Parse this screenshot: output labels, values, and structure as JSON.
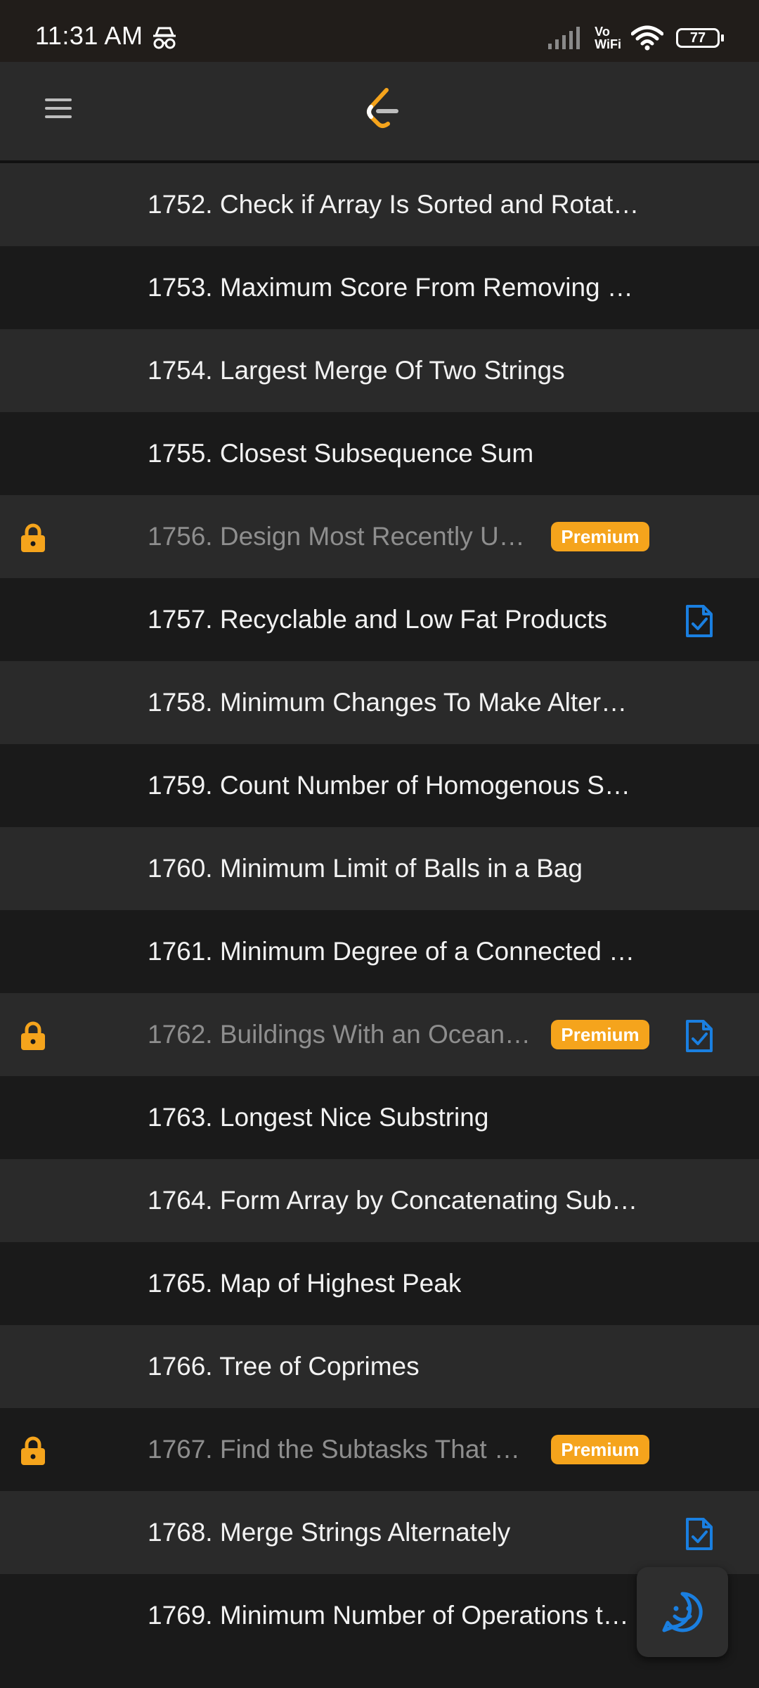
{
  "status_bar": {
    "time": "11:31 AM",
    "vo": "Vo",
    "wifi_label": "WiFi",
    "battery": "77",
    "icons": [
      "incognito-icon",
      "signal-icon",
      "wifi-icon",
      "battery-icon"
    ]
  },
  "header": {
    "menu_icon": "hamburger-menu-icon",
    "logo_icon": "leetcode-logo"
  },
  "colors": {
    "premium_badge": "#f5a41c",
    "lock": "#f5a41c",
    "solution_icon": "#1a7fe0",
    "row_light": "#2a2a2a",
    "row_dark": "#1a1a1a"
  },
  "problems": [
    {
      "title": "1752. Check if Array Is Sorted and Rotat…",
      "locked": false,
      "premium": "",
      "solution": false
    },
    {
      "title": "1753. Maximum Score From Removing …",
      "locked": false,
      "premium": "",
      "solution": false
    },
    {
      "title": "1754. Largest Merge Of Two Strings",
      "locked": false,
      "premium": "",
      "solution": false
    },
    {
      "title": "1755. Closest Subsequence Sum",
      "locked": false,
      "premium": "",
      "solution": false
    },
    {
      "title": "1756. Design Most Recently U…",
      "locked": true,
      "premium": "Premium",
      "solution": false
    },
    {
      "title": "1757. Recyclable and Low Fat Products",
      "locked": false,
      "premium": "",
      "solution": true
    },
    {
      "title": "1758. Minimum Changes To Make Alter…",
      "locked": false,
      "premium": "",
      "solution": false
    },
    {
      "title": "1759. Count Number of Homogenous S…",
      "locked": false,
      "premium": "",
      "solution": false
    },
    {
      "title": "1760. Minimum Limit of Balls in a Bag",
      "locked": false,
      "premium": "",
      "solution": false
    },
    {
      "title": "1761. Minimum Degree of a Connected …",
      "locked": false,
      "premium": "",
      "solution": false
    },
    {
      "title": "1762. Buildings With an Ocean…",
      "locked": true,
      "premium": "Premium",
      "solution": true
    },
    {
      "title": "1763. Longest Nice Substring",
      "locked": false,
      "premium": "",
      "solution": false
    },
    {
      "title": "1764. Form Array by Concatenating Sub…",
      "locked": false,
      "premium": "",
      "solution": false
    },
    {
      "title": "1765. Map of Highest Peak",
      "locked": false,
      "premium": "",
      "solution": false
    },
    {
      "title": "1766. Tree of Coprimes",
      "locked": false,
      "premium": "",
      "solution": false
    },
    {
      "title": "1767. Find the Subtasks That …",
      "locked": true,
      "premium": "Premium",
      "solution": false
    },
    {
      "title": "1768. Merge Strings Alternately",
      "locked": false,
      "premium": "",
      "solution": true
    },
    {
      "title": "1769. Minimum Number of Operations t…",
      "locked": false,
      "premium": "",
      "solution": false
    }
  ],
  "fab": {
    "icon": "chat-smiley-icon"
  }
}
